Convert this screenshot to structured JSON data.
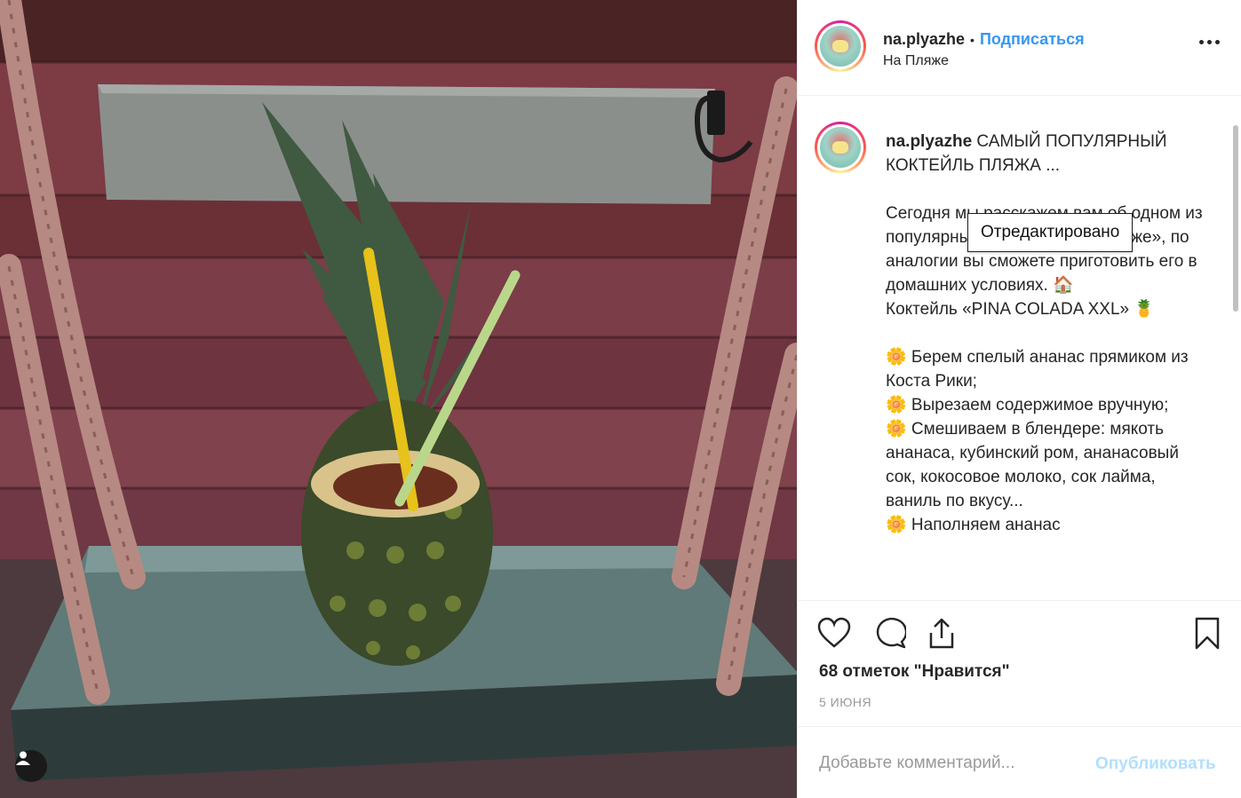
{
  "post": {
    "username": "na.plyazhe",
    "follow_label": "Подписаться",
    "separator": "•",
    "location": "На Пляже"
  },
  "caption": {
    "username": "na.plyazhe",
    "text": " САМЫЙ ПОПУЛЯРНЫЙ КОКТЕЙЛЬ ПЛЯЖА ...\n\nСегодня мы расскажем вам об одном из популярных коктейлях «На пляже», по аналогии вы сможете приготовить его в домашних условиях. 🏠\nКоктейль «PINA COLADA XXL» 🍍\n\n🌼 Берем спелый ананас прямиком из Коста Рики;\n🌼 Вырезаем содержимое вручную;\n🌼 Смешиваем в блендере: мякоть ананаса, кубинский ром, ананасовый сок, кокосовое молоко, сок лайма, ваниль по вкусу...\n🌼 Наполняем ананас",
    "tooltip": "Отредактировано"
  },
  "actions": {
    "likes": "68 отметок \"Нравится\"",
    "date": "5 ИЮНЯ"
  },
  "comment": {
    "placeholder": "Добавьте комментарий...",
    "publish_label": "Опубликовать"
  },
  "colors": {
    "accent": "#3897f0",
    "publish_disabled": "#b2dffc",
    "muted": "#999999",
    "text": "#262626"
  },
  "icons": {
    "like": "heart-icon",
    "comment": "comment-icon",
    "share": "share-icon",
    "save": "bookmark-icon",
    "more": "more-options-icon",
    "user_tag": "user-tag-icon"
  }
}
